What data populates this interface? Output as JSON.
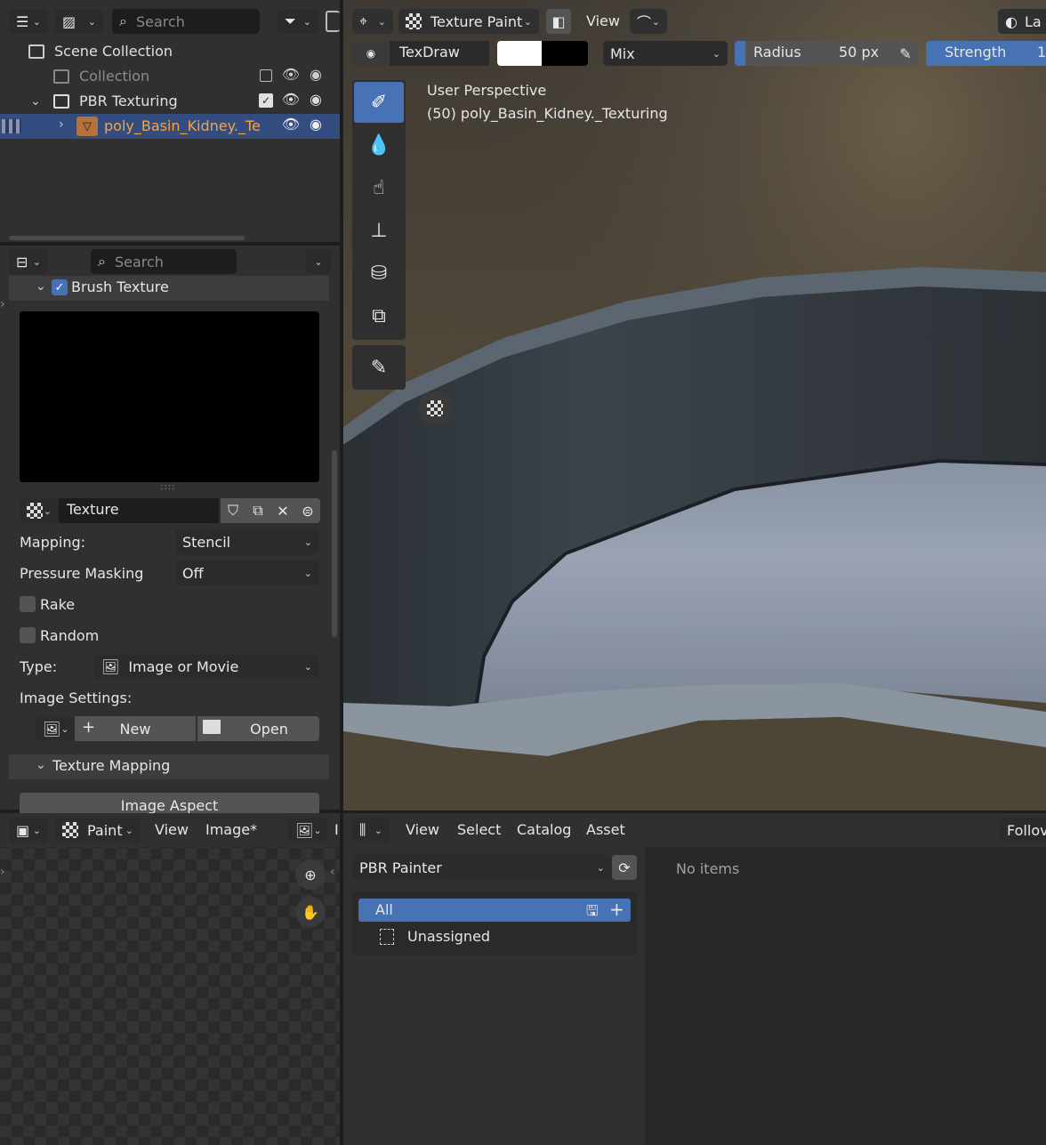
{
  "outliner": {
    "search_placeholder": "Search",
    "items": [
      {
        "label": "Scene Collection"
      },
      {
        "label": "Collection"
      },
      {
        "label": "PBR Texturing"
      },
      {
        "label": "poly_Basin_Kidney._Te"
      }
    ]
  },
  "properties": {
    "search_placeholder": "Search",
    "brush_texture_label": "Brush Texture",
    "texture_name": "Texture",
    "mapping_label": "Mapping:",
    "mapping_value": "Stencil",
    "pressure_label": "Pressure Masking",
    "pressure_value": "Off",
    "rake_label": "Rake",
    "random_label": "Random",
    "type_label": "Type:",
    "type_value": "Image or Movie",
    "image_settings_label": "Image Settings:",
    "new_label": "New",
    "open_label": "Open",
    "texture_mapping_label": "Texture Mapping",
    "image_aspect_label": "Image Aspect"
  },
  "viewport": {
    "mode": "Texture Paint",
    "view_menu": "View",
    "layer_partial": "La",
    "brush_name": "TexDraw",
    "blend": "Mix",
    "radius_label": "Radius",
    "radius_value": "50 px",
    "strength_label": "Strength",
    "strength_partial": "1",
    "overlay_title": "User Perspective",
    "overlay_object": "(50) poly_Basin_Kidney._Texturing"
  },
  "image_editor": {
    "mode": "Paint",
    "menus": [
      "View",
      "Image*"
    ],
    "partial": "I"
  },
  "asset_browser": {
    "menus": [
      "View",
      "Select",
      "Catalog",
      "Asset"
    ],
    "follow_partial": "Follov",
    "library": "PBR Painter",
    "catalogs": [
      {
        "label": "All"
      },
      {
        "label": "Unassigned"
      }
    ],
    "empty_text": "No items"
  },
  "colors": {
    "accent": "#4772b3",
    "selected_text": "#f7a43c",
    "panel": "#303030"
  }
}
